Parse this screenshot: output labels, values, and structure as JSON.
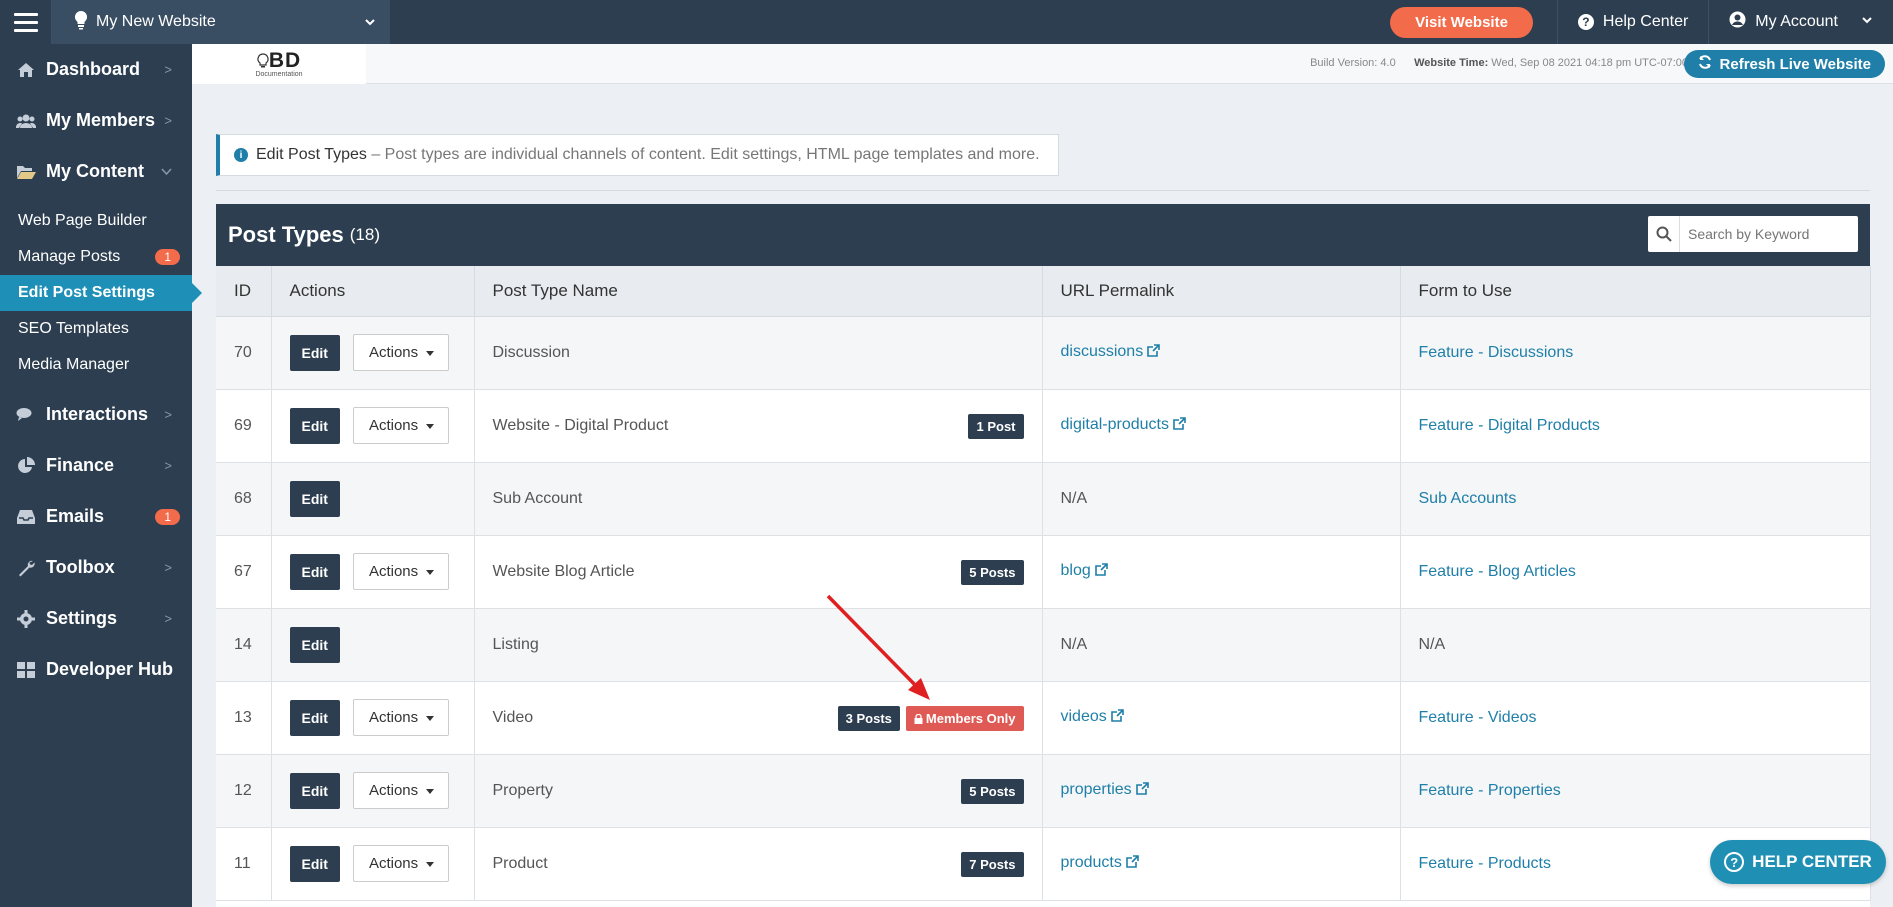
{
  "topbar": {
    "site_name": "My New Website",
    "visit_label": "Visit Website",
    "help_label": "Help Center",
    "account_label": "My Account"
  },
  "sidebar": {
    "items": [
      {
        "label": "Dashboard",
        "icon": "home-icon"
      },
      {
        "label": "My Members",
        "icon": "users-icon"
      },
      {
        "label": "My Content",
        "icon": "folder-open-icon"
      },
      {
        "label": "Interactions",
        "icon": "comments-icon"
      },
      {
        "label": "Finance",
        "icon": "pie-chart-icon"
      },
      {
        "label": "Emails",
        "icon": "inbox-icon",
        "badge": "1"
      },
      {
        "label": "Toolbox",
        "icon": "wrench-icon"
      },
      {
        "label": "Settings",
        "icon": "gear-icon"
      },
      {
        "label": "Developer Hub",
        "icon": "grid-icon"
      }
    ],
    "sub_items": [
      {
        "label": "Web Page Builder"
      },
      {
        "label": "Manage Posts",
        "badge": "1"
      },
      {
        "label": "Edit Post Settings"
      },
      {
        "label": "SEO Templates"
      },
      {
        "label": "Media Manager"
      }
    ]
  },
  "infobar": {
    "logo_text": "BD",
    "logo_sub": "Documentation",
    "build_label": "Build Version:",
    "build_value": "4.0",
    "time_label": "Website Time:",
    "time_value": "Wed, Sep 08 2021 04:18 pm UTC-07:00",
    "refresh_label": "Refresh Live Website"
  },
  "alert": {
    "title": "Edit Post Types",
    "text": "– Post types are individual channels of content. Edit settings, HTML page templates and more."
  },
  "panel": {
    "title": "Post Types",
    "count": "(18)",
    "search_placeholder": "Search by Keyword"
  },
  "table": {
    "headers": [
      "ID",
      "Actions",
      "Post Type Name",
      "URL Permalink",
      "Form to Use"
    ],
    "edit_label": "Edit",
    "actions_label": "Actions",
    "rows": [
      {
        "id": "70",
        "name": "Discussion",
        "url": "discussions",
        "form": "Feature - Discussions"
      },
      {
        "id": "69",
        "name": "Website - Digital Product",
        "posts": "1 Post",
        "url": "digital-products",
        "form": "Feature - Digital Products"
      },
      {
        "id": "68",
        "name": "Sub Account",
        "url": "N/A",
        "form": "Sub Accounts"
      },
      {
        "id": "67",
        "name": "Website Blog Article",
        "posts": "5 Posts",
        "url": "blog",
        "form": "Feature - Blog Articles"
      },
      {
        "id": "14",
        "name": "Listing",
        "url": "N/A",
        "form": "N/A"
      },
      {
        "id": "13",
        "name": "Video",
        "posts": "3 Posts",
        "members": "Members Only",
        "url": "videos",
        "form": "Feature - Videos"
      },
      {
        "id": "12",
        "name": "Property",
        "posts": "5 Posts",
        "url": "properties",
        "form": "Feature - Properties"
      },
      {
        "id": "11",
        "name": "Product",
        "posts": "7 Posts",
        "url": "products",
        "form": "Feature - Products"
      }
    ]
  },
  "help_float": {
    "label": "HELP CENTER"
  },
  "colors": {
    "navy": "#2c3e50",
    "orange": "#f26b4a",
    "blue": "#1f7fa8",
    "red": "#e05a55"
  }
}
